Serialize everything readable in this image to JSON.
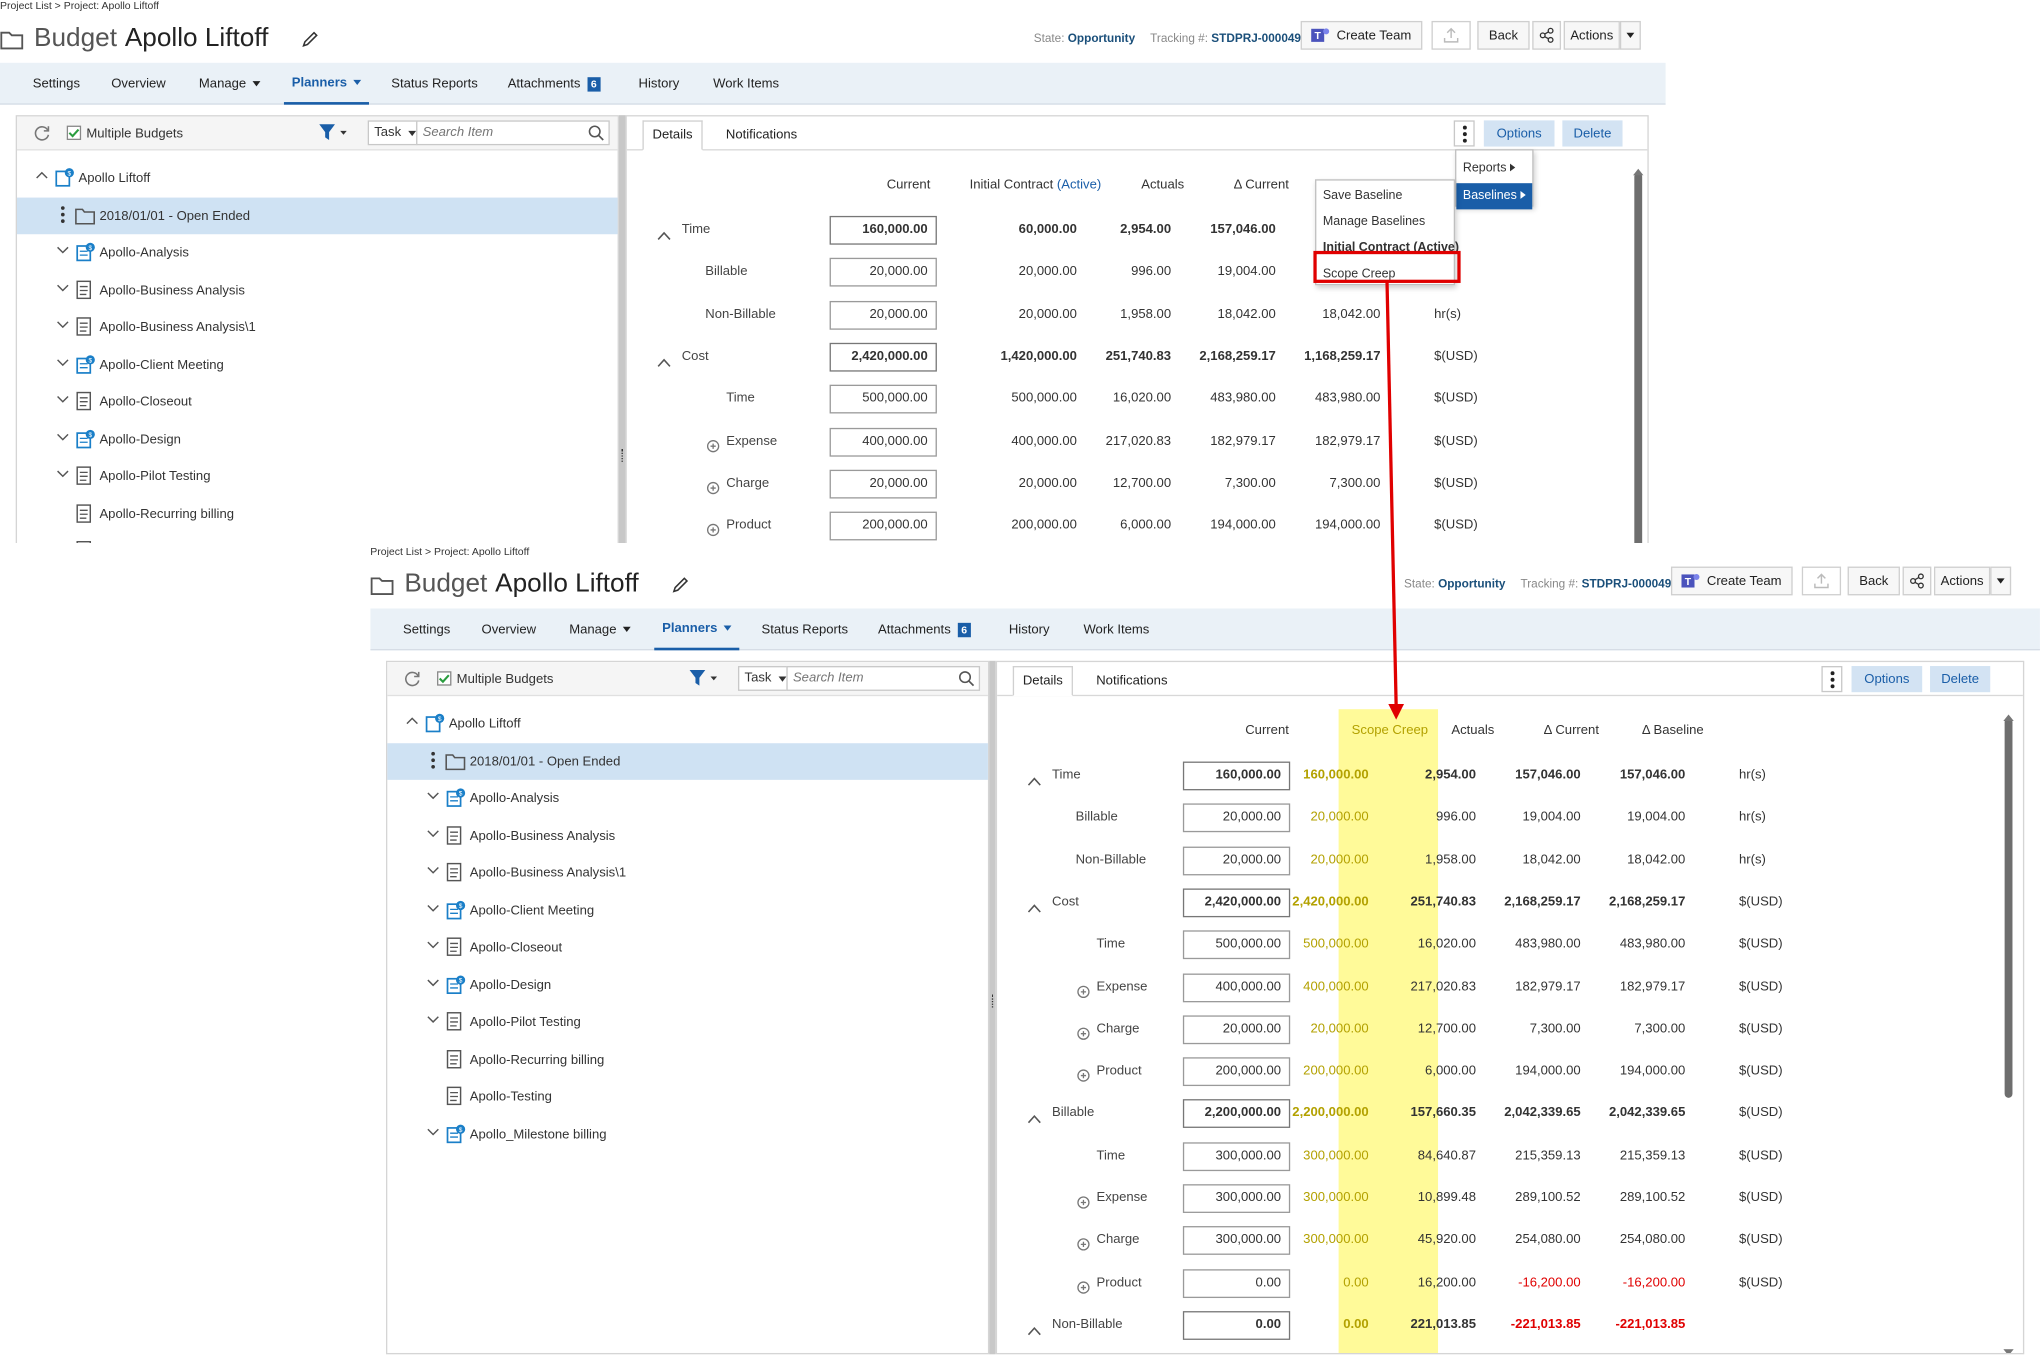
{
  "breadcrumb": "Project List > Project: Apollo Liftoff",
  "title": {
    "prefix": "Budget",
    "name": "Apollo Liftoff"
  },
  "state": {
    "label": "State:",
    "value": "Opportunity"
  },
  "tracking": {
    "label": "Tracking #:",
    "value": "STDPRJ-000049"
  },
  "buttons": {
    "create_team": "Create Team",
    "back": "Back",
    "actions": "Actions"
  },
  "tabs": [
    {
      "label": "Settings"
    },
    {
      "label": "Overview"
    },
    {
      "label": "Manage",
      "dropdown": true
    },
    {
      "label": "Planners",
      "dropdown": true,
      "active": true
    },
    {
      "label": "Status Reports"
    },
    {
      "label": "Attachments",
      "badge": "6"
    },
    {
      "label": "History"
    },
    {
      "label": "Work Items"
    }
  ],
  "left_panel": {
    "multiple_budgets": "Multiple Budgets",
    "task_select": "Task",
    "search_placeholder": "Search Item",
    "tree": [
      {
        "label": "Apollo Liftoff",
        "icon": "project-icon",
        "expand": "up",
        "indent": 0
      },
      {
        "label": "2018/01/01 - Open Ended",
        "icon": "folder-icon",
        "expand": "kebab",
        "indent": 1,
        "selected": true
      },
      {
        "label": "Apollo-Analysis",
        "icon": "task-badge-icon",
        "expand": "down",
        "indent": 1
      },
      {
        "label": "Apollo-Business Analysis",
        "icon": "task-icon",
        "expand": "down",
        "indent": 1
      },
      {
        "label": "Apollo-Business Analysis\\1",
        "icon": "task-icon",
        "expand": "down",
        "indent": 1
      },
      {
        "label": "Apollo-Client Meeting",
        "icon": "task-badge-icon",
        "expand": "down",
        "indent": 1
      },
      {
        "label": "Apollo-Closeout",
        "icon": "task-icon",
        "expand": "down",
        "indent": 1
      },
      {
        "label": "Apollo-Design",
        "icon": "task-badge-icon",
        "expand": "down",
        "indent": 1
      },
      {
        "label": "Apollo-Pilot Testing",
        "icon": "task-icon",
        "expand": "down",
        "indent": 1
      },
      {
        "label": "Apollo-Recurring billing",
        "icon": "task-icon",
        "expand": "none",
        "indent": 1
      },
      {
        "label": "Apollo-Testing",
        "icon": "task-icon",
        "expand": "none",
        "indent": 1
      },
      {
        "label": "Apollo_Milestone billing",
        "icon": "task-badge-icon",
        "expand": "down",
        "indent": 1
      }
    ]
  },
  "right_panel": {
    "tabs": [
      "Details",
      "Notifications"
    ],
    "options": "Options",
    "delete": "Delete"
  },
  "before": {
    "columns": [
      "Current",
      "Initial Contract",
      "(Active)",
      "Actuals",
      "Δ Current"
    ],
    "rows": [
      {
        "label": "Time",
        "kind": "group",
        "current": "160,000.00",
        "initial": "60,000.00",
        "actuals": "2,954.00",
        "dcur": "157,046.00",
        "dbase": "",
        "unit": ""
      },
      {
        "label": "Billable",
        "kind": "child",
        "current": "20,000.00",
        "initial": "20,000.00",
        "actuals": "996.00",
        "dcur": "19,004.00",
        "dbase": "",
        "unit": ""
      },
      {
        "label": "Non-Billable",
        "kind": "child",
        "current": "20,000.00",
        "initial": "20,000.00",
        "actuals": "1,958.00",
        "dcur": "18,042.00",
        "dbase": "18,042.00",
        "unit": "hr(s)"
      },
      {
        "label": "Cost",
        "kind": "group",
        "current": "2,420,000.00",
        "initial": "1,420,000.00",
        "actuals": "251,740.83",
        "dcur": "2,168,259.17",
        "dbase": "1,168,259.17",
        "unit": "$(USD)"
      },
      {
        "label": "Time",
        "kind": "child",
        "current": "500,000.00",
        "initial": "500,000.00",
        "actuals": "16,020.00",
        "dcur": "483,980.00",
        "dbase": "483,980.00",
        "unit": "$(USD)"
      },
      {
        "label": "Expense",
        "kind": "plus",
        "current": "400,000.00",
        "initial": "400,000.00",
        "actuals": "217,020.83",
        "dcur": "182,979.17",
        "dbase": "182,979.17",
        "unit": "$(USD)"
      },
      {
        "label": "Charge",
        "kind": "plus",
        "current": "20,000.00",
        "initial": "20,000.00",
        "actuals": "12,700.00",
        "dcur": "7,300.00",
        "dbase": "7,300.00",
        "unit": "$(USD)"
      },
      {
        "label": "Product",
        "kind": "plus",
        "current": "200,000.00",
        "initial": "200,000.00",
        "actuals": "6,000.00",
        "dcur": "194,000.00",
        "dbase": "194,000.00",
        "unit": "$(USD)"
      }
    ],
    "options_menu": {
      "reports": "Reports",
      "baselines": "Baselines"
    },
    "baselines_menu": [
      "Save Baseline",
      "Manage Baselines",
      "Initial Contract (Active)",
      "Scope Creep"
    ]
  },
  "after": {
    "columns": [
      "Current",
      "Scope Creep",
      "Actuals",
      "Δ Current",
      "Δ Baseline"
    ],
    "rows": [
      {
        "label": "Time",
        "kind": "group",
        "current": "160,000.00",
        "scope": "160,000.00",
        "actuals": "2,954.00",
        "dcur": "157,046.00",
        "dbase": "157,046.00",
        "unit": "hr(s)"
      },
      {
        "label": "Billable",
        "kind": "child",
        "current": "20,000.00",
        "scope": "20,000.00",
        "actuals": "996.00",
        "dcur": "19,004.00",
        "dbase": "19,004.00",
        "unit": "hr(s)"
      },
      {
        "label": "Non-Billable",
        "kind": "child",
        "current": "20,000.00",
        "scope": "20,000.00",
        "actuals": "1,958.00",
        "dcur": "18,042.00",
        "dbase": "18,042.00",
        "unit": "hr(s)"
      },
      {
        "label": "Cost",
        "kind": "group",
        "current": "2,420,000.00",
        "scope": "2,420,000.00",
        "actuals": "251,740.83",
        "dcur": "2,168,259.17",
        "dbase": "2,168,259.17",
        "unit": "$(USD)"
      },
      {
        "label": "Time",
        "kind": "child",
        "current": "500,000.00",
        "scope": "500,000.00",
        "actuals": "16,020.00",
        "dcur": "483,980.00",
        "dbase": "483,980.00",
        "unit": "$(USD)"
      },
      {
        "label": "Expense",
        "kind": "plus",
        "current": "400,000.00",
        "scope": "400,000.00",
        "actuals": "217,020.83",
        "dcur": "182,979.17",
        "dbase": "182,979.17",
        "unit": "$(USD)"
      },
      {
        "label": "Charge",
        "kind": "plus",
        "current": "20,000.00",
        "scope": "20,000.00",
        "actuals": "12,700.00",
        "dcur": "7,300.00",
        "dbase": "7,300.00",
        "unit": "$(USD)"
      },
      {
        "label": "Product",
        "kind": "plus",
        "current": "200,000.00",
        "scope": "200,000.00",
        "actuals": "6,000.00",
        "dcur": "194,000.00",
        "dbase": "194,000.00",
        "unit": "$(USD)"
      },
      {
        "label": "Billable",
        "kind": "group",
        "current": "2,200,000.00",
        "scope": "2,200,000.00",
        "actuals": "157,660.35",
        "dcur": "2,042,339.65",
        "dbase": "2,042,339.65",
        "unit": "$(USD)"
      },
      {
        "label": "Time",
        "kind": "child",
        "current": "300,000.00",
        "scope": "300,000.00",
        "actuals": "84,640.87",
        "dcur": "215,359.13",
        "dbase": "215,359.13",
        "unit": "$(USD)"
      },
      {
        "label": "Expense",
        "kind": "plus",
        "current": "300,000.00",
        "scope": "300,000.00",
        "actuals": "10,899.48",
        "dcur": "289,100.52",
        "dbase": "289,100.52",
        "unit": "$(USD)"
      },
      {
        "label": "Charge",
        "kind": "plus",
        "current": "300,000.00",
        "scope": "300,000.00",
        "actuals": "45,920.00",
        "dcur": "254,080.00",
        "dbase": "254,080.00",
        "unit": "$(USD)"
      },
      {
        "label": "Product",
        "kind": "plus",
        "current": "0.00",
        "scope": "0.00",
        "actuals": "16,200.00",
        "dcur": "-16,200.00",
        "dbase": "-16,200.00",
        "unit": "$(USD)",
        "negative": true
      },
      {
        "label": "Non-Billable",
        "kind": "group",
        "current": "0.00",
        "scope": "0.00",
        "actuals": "221,013.85",
        "dcur": "-221,013.85",
        "dbase": "-221,013.85",
        "unit": "",
        "negative": true
      }
    ]
  },
  "colors": {
    "accent": "#1a5ea8",
    "highlight": "#fffa99",
    "scope_text": "#b3a100",
    "negative": "#e00000",
    "annotation": "#e00000"
  }
}
